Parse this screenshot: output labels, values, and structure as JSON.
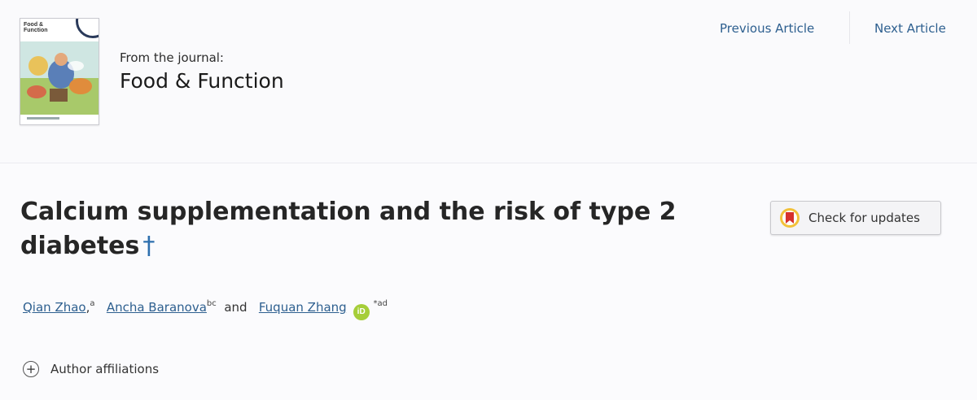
{
  "journal": {
    "cover_title": "Food & Function",
    "from_label": "From the journal:",
    "name": "Food & Function"
  },
  "nav": {
    "previous": "Previous Article",
    "next": "Next Article"
  },
  "article": {
    "title": "Calcium supplementation and the risk of type 2 diabetes",
    "dagger": "†"
  },
  "check_updates": {
    "label": "Check for updates",
    "icon": "crossmark-icon"
  },
  "authors": [
    {
      "name": "Qian Zhao",
      "sup": "a"
    },
    {
      "name": "Ancha Baranova",
      "sup": "bc"
    },
    {
      "name": "Fuquan Zhang",
      "sup": "*ad"
    }
  ],
  "authors_separator_1": ",",
  "authors_and": "and",
  "orcid_label": "iD",
  "affiliations": {
    "label": "Author affiliations",
    "icon": "plus-circle-icon"
  },
  "colors": {
    "link": "#2d5f8f",
    "orcid": "#a6ce39",
    "title_text": "#262626"
  }
}
